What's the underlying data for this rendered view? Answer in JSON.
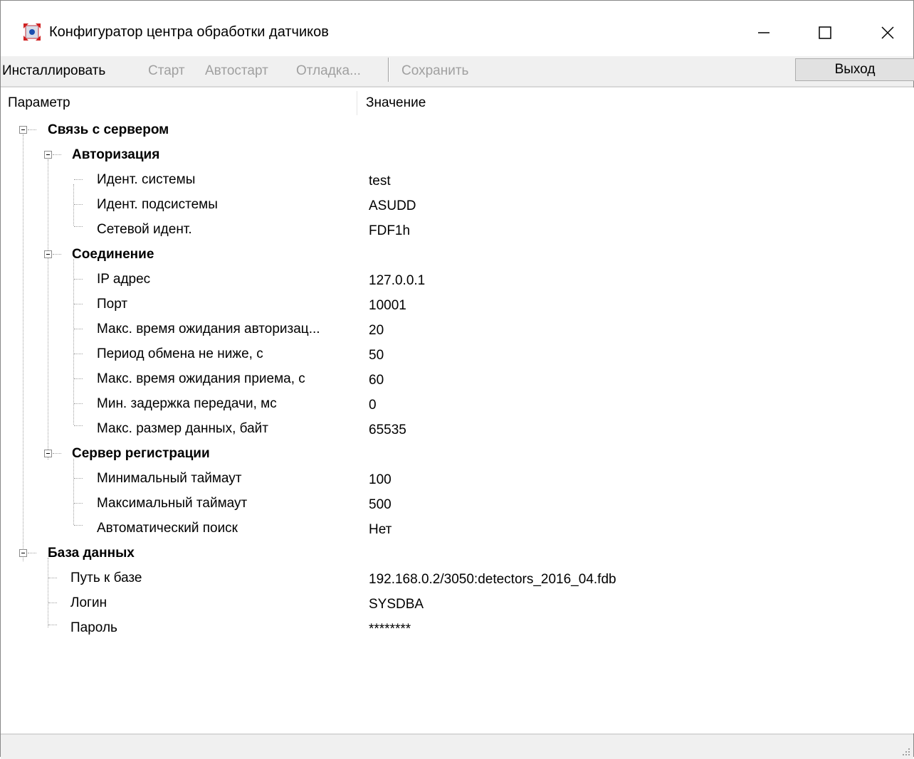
{
  "window": {
    "title": "Конфигуратор центра обработки датчиков"
  },
  "toolbar": {
    "install": "Инсталлировать",
    "start": "Старт",
    "autostart": "Автостарт",
    "debug": "Отладка...",
    "save": "Сохранить",
    "exit": "Выход"
  },
  "columns": {
    "param": "Параметр",
    "value": "Значение"
  },
  "tree": {
    "server": {
      "label": "Связь с сервером",
      "auth": {
        "label": "Авторизация",
        "items": [
          {
            "label": "Идент. системы",
            "value": "test"
          },
          {
            "label": "Идент. подсистемы",
            "value": "ASUDD"
          },
          {
            "label": "Сетевой идент.",
            "value": "FDF1h"
          }
        ]
      },
      "conn": {
        "label": "Соединение",
        "items": [
          {
            "label": "IP адрес",
            "value": "127.0.0.1"
          },
          {
            "label": "Порт",
            "value": "10001"
          },
          {
            "label": "Макс. время ожидания авторизац...",
            "value": "20"
          },
          {
            "label": "Период обмена не ниже, с",
            "value": "50"
          },
          {
            "label": "Макс. время ожидания приема, с",
            "value": "60"
          },
          {
            "label": "Мин. задержка передачи, мс",
            "value": "0"
          },
          {
            "label": "Макс. размер данных, байт",
            "value": "65535"
          }
        ]
      },
      "reg": {
        "label": "Сервер регистрации",
        "items": [
          {
            "label": "Минимальный таймаут",
            "value": "100"
          },
          {
            "label": "Максимальный таймаут",
            "value": "500"
          },
          {
            "label": "Автоматический поиск",
            "value": "Нет"
          }
        ]
      }
    },
    "db": {
      "label": "База данных",
      "items": [
        {
          "label": "Путь к базе",
          "value": "192.168.0.2/3050:detectors_2016_04.fdb"
        },
        {
          "label": "Логин",
          "value": "SYSDBA"
        },
        {
          "label": "Пароль",
          "value": "********"
        }
      ]
    }
  },
  "icons": {
    "app": "sensor-center-icon",
    "minimize": "minimize-icon",
    "maximize": "maximize-icon",
    "close": "close-icon"
  }
}
